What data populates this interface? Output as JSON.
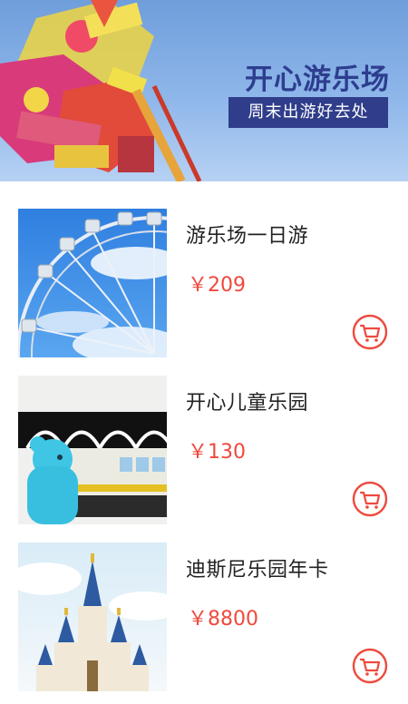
{
  "banner": {
    "title": "开心游乐场",
    "subtitle": "周末出游好去处"
  },
  "products": [
    {
      "title": "游乐场一日游",
      "price": "￥209",
      "image": "ferris-wheel"
    },
    {
      "title": "开心儿童乐园",
      "price": "￥130",
      "image": "kids-train-bear"
    },
    {
      "title": "迪斯尼乐园年卡",
      "price": "￥8800",
      "image": "castle"
    }
  ],
  "colors": {
    "accent": "#ee4a3e",
    "banner_title": "#2e3d8f",
    "banner_sub_bg": "#2f3d8a"
  },
  "icons": {
    "cart": "cart-icon"
  }
}
